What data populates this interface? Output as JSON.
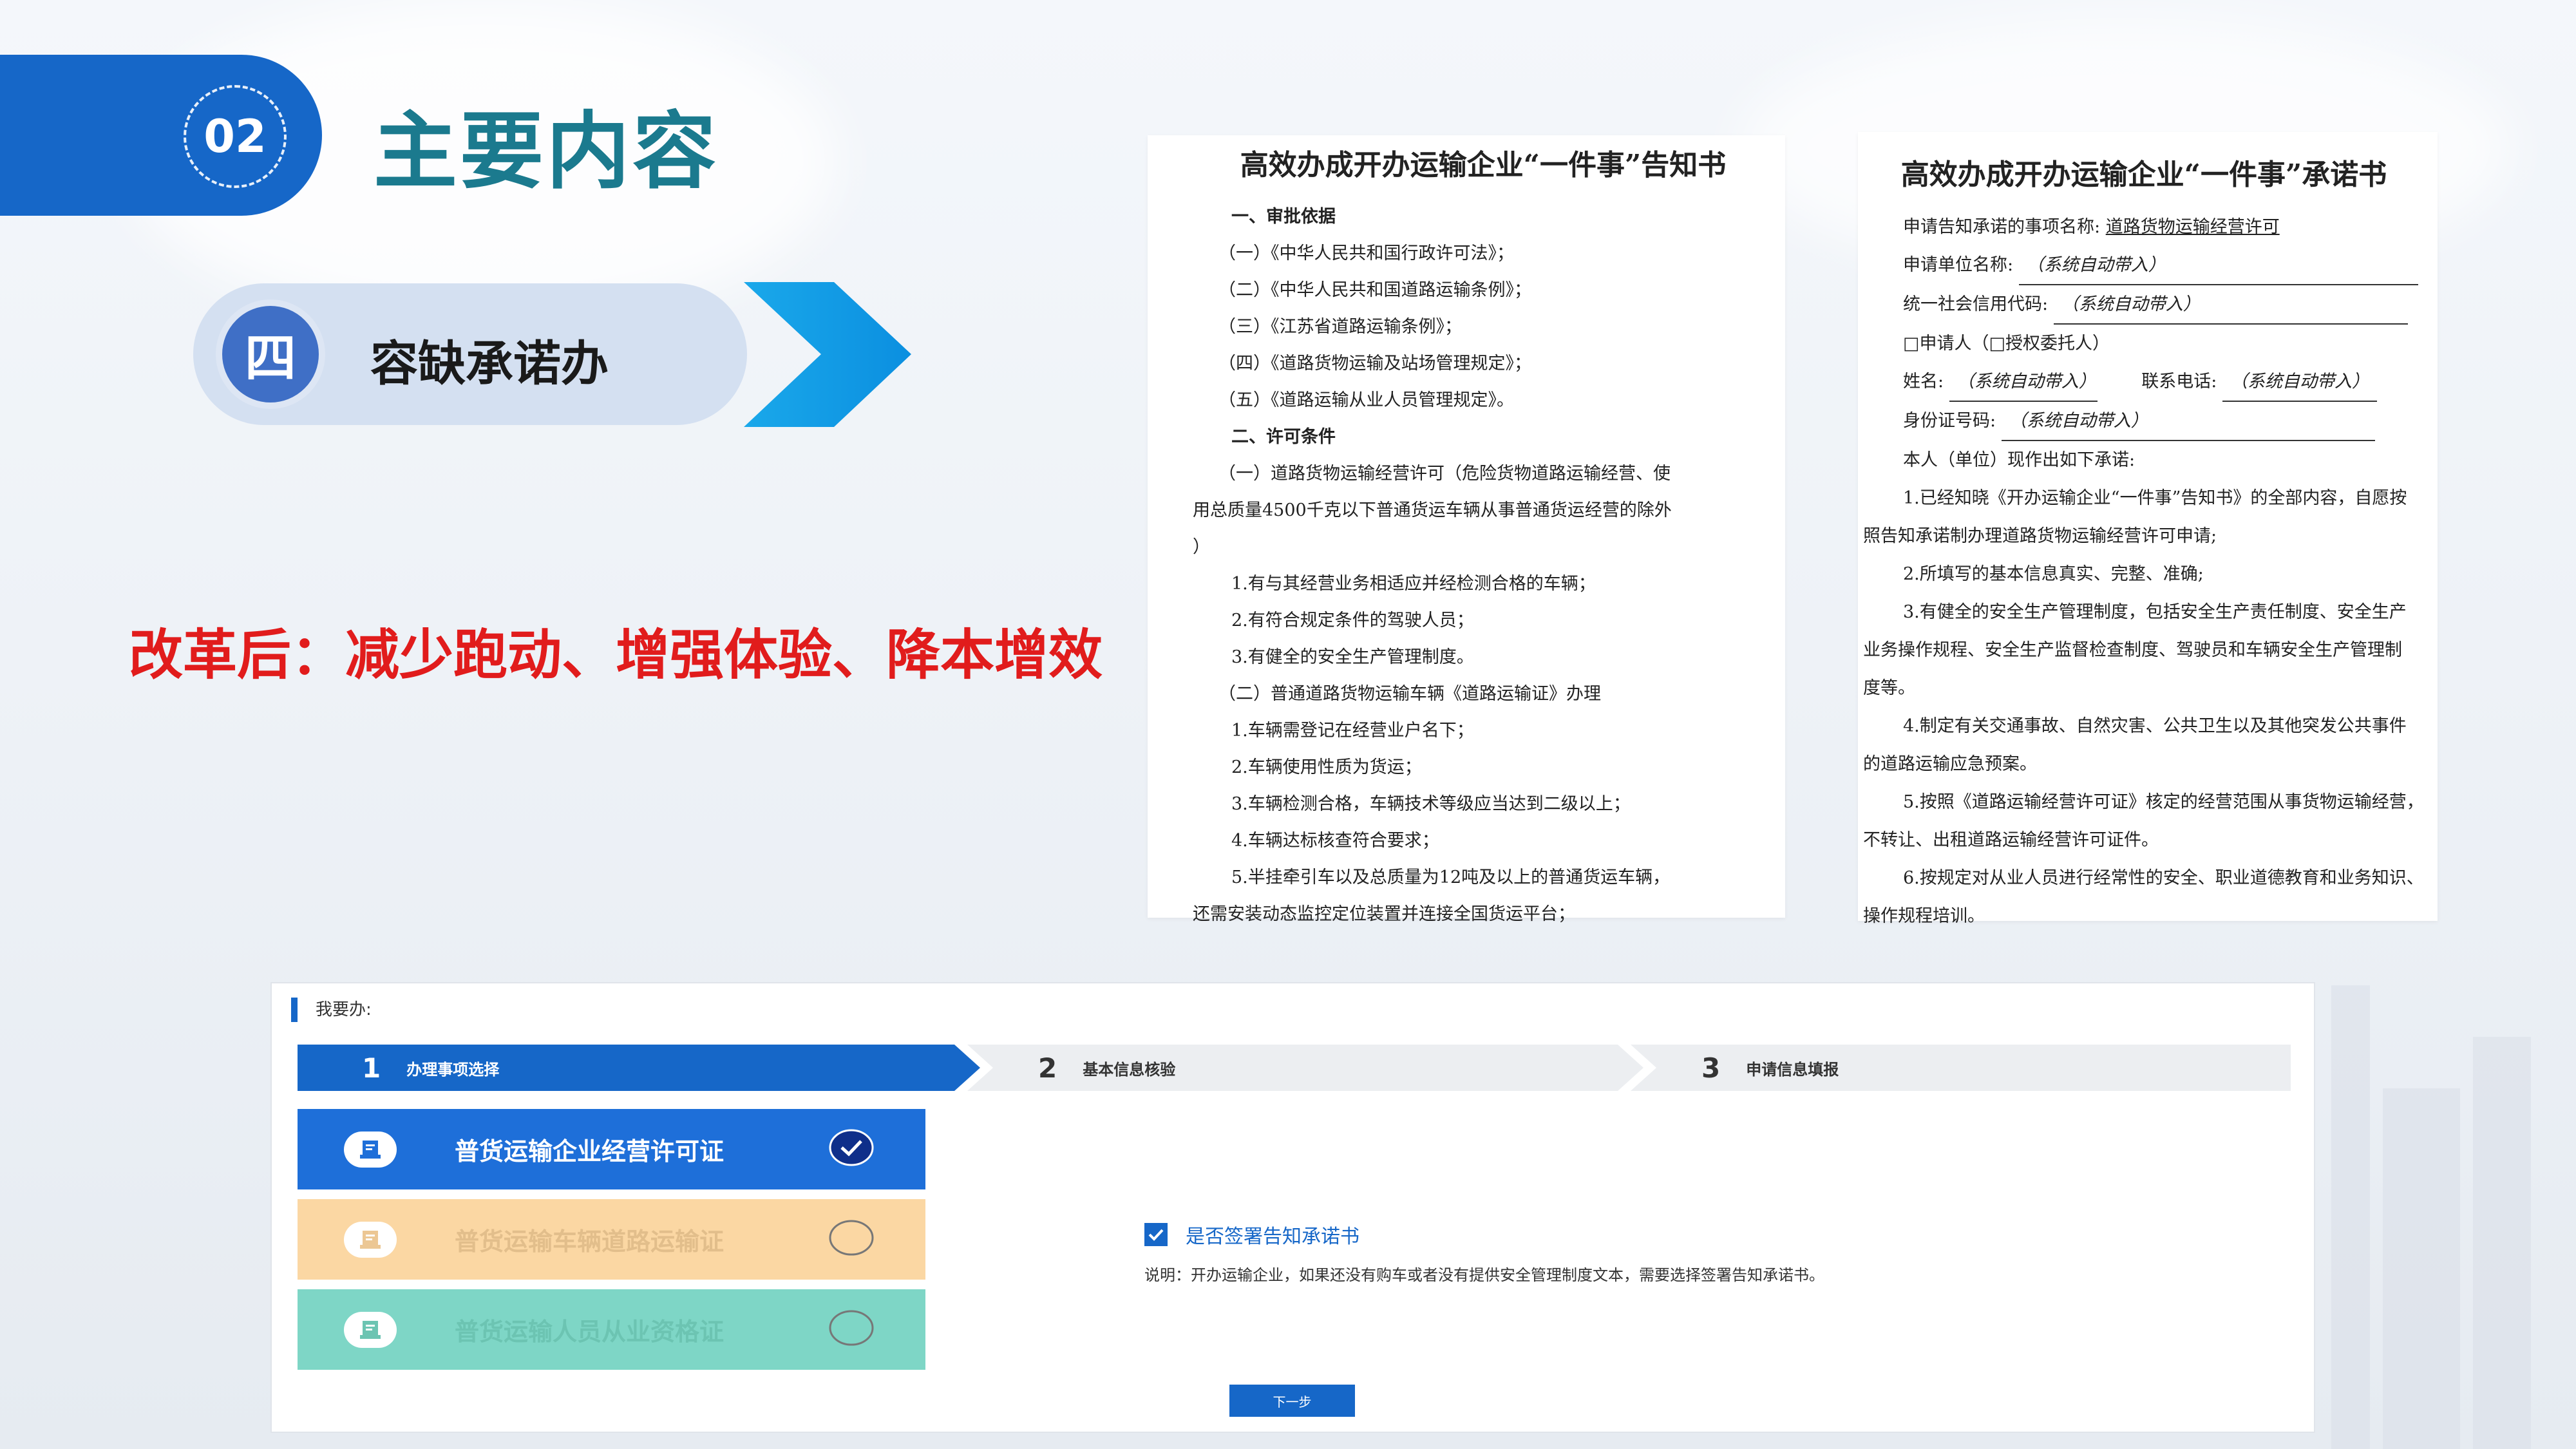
{
  "header": {
    "section_number": "02",
    "title": "主要内容"
  },
  "section": {
    "number": "四",
    "label": "容缺承诺办"
  },
  "reform_text": "改革后：减少跑动、增强体验、降本增效",
  "doc_notice": {
    "title": "高效办成开办运输企业“一件事”告知书",
    "lines": [
      "一、审批依据",
      "（一）《中华人民共和国行政许可法》；",
      "（二）《中华人民共和国道路运输条例》；",
      "（三）《江苏省道路运输条例》；",
      "（四）《道路货物运输及站场管理规定》；",
      "（五）《道路运输从业人员管理规定》。",
      "二、许可条件",
      "（一）道路货物运输经营许可（危险货物道路运输经营、使",
      "用总质量4500千克以下普通货运车辆从事普通货运经营的除外",
      "）",
      "1.有与其经营业务相适应并经检测合格的车辆；",
      "2.有符合规定条件的驾驶人员；",
      "3.有健全的安全生产管理制度。",
      "（二）普通道路货物运输车辆《道路运输证》办理",
      "1.车辆需登记在经营业户名下；",
      "2.车辆使用性质为货运；",
      "3.车辆检测合格，车辆技术等级应当达到二级以上；",
      "4.车辆达标核查符合要求；",
      "5.半挂牵引车以及总质量为12吨及以上的普通货运车辆，",
      "还需安装动态监控定位装置并连接全国货运平台；"
    ]
  },
  "doc_commit": {
    "title": "高效办成开办运输企业“一件事”承诺书",
    "item_label": "申请告知承诺的事项名称:",
    "item_value": "道路货物运输经营许可",
    "unit_label": "申请单位名称:",
    "auto": "（系统自动带入）",
    "credit_label": "统一社会信用代码:",
    "applicant_line": "□申请人（□授权委托人）",
    "name_label": "姓名:",
    "phone_label": "联系电话:",
    "id_label": "身份证号码:",
    "lines": [
      "本人（单位）现作出如下承诺:",
      "1.已经知晓《开办运输企业“一件事”告知书》的全部内容，自愿按",
      "照告知承诺制办理道路货物运输经营许可申请;",
      "2.所填写的基本信息真实、完整、准确;",
      "3.有健全的安全生产管理制度，包括安全生产责任制度、安全生产",
      "业务操作规程、安全生产监督检查制度、驾驶员和车辆安全生产管理制",
      "度等。",
      "4.制定有关交通事故、自然灾害、公共卫生以及其他突发公共事件",
      "的道路运输应急预案。",
      "5.按照《道路运输经营许可证》核定的经营范围从事货物运输经营，",
      "不转让、出租道路运输经营许可证件。",
      "6.按规定对从业人员进行经常性的安全、职业道德教育和业务知识、",
      "操作规程培训。"
    ]
  },
  "portal": {
    "heading": "我要办:",
    "steps": [
      {
        "num": "1",
        "label": "办理事项选择"
      },
      {
        "num": "2",
        "label": "基本信息核验"
      },
      {
        "num": "3",
        "label": "申请信息填报"
      }
    ],
    "options": [
      {
        "label": "普货运输企业经营许可证",
        "selected": true
      },
      {
        "label": "普货运输车辆道路运输证",
        "selected": false
      },
      {
        "label": "普货运输人员从业资格证",
        "selected": false
      }
    ],
    "sign_label": "是否签署告知承诺书",
    "note": "说明：开办运输企业，如果还没有购车或者没有提供安全管理制度文本，需要选择签署告知承诺书。",
    "next_button": "下一步"
  },
  "colors": {
    "brand_blue": "#1667c8",
    "title_teal": "#1b7a8e",
    "reform_red": "#e11c1c",
    "option_orange": "#fbd7a3",
    "option_teal": "#7ed6c6"
  }
}
